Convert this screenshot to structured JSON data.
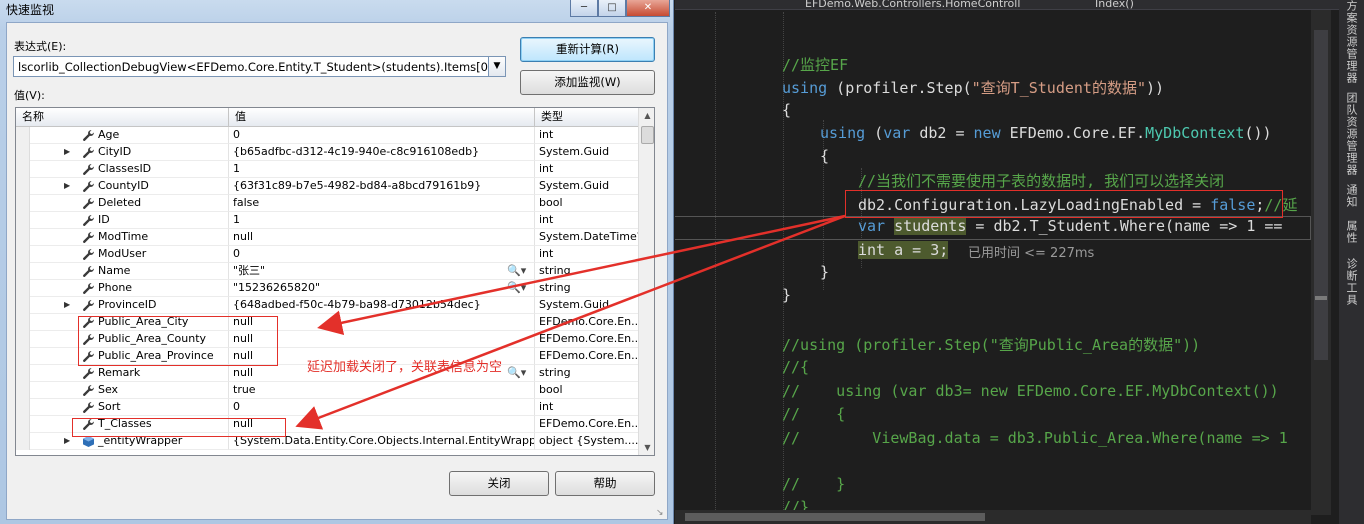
{
  "dialog": {
    "title": "快速监视",
    "expression_label": "表达式(E):",
    "expression_value": "lscorlib_CollectionDebugView<EFDemo.Core.Entity.T_Student>(students).Items[0]",
    "value_label": "值(V):",
    "recalc_button": "重新计算(R)",
    "add_watch_button": "添加监视(W)",
    "close_button": "关闭",
    "help_button": "帮助",
    "columns": [
      "名称",
      "值",
      "类型"
    ],
    "rows": [
      {
        "name": "Age",
        "value": "0",
        "type": "int",
        "expand": false
      },
      {
        "name": "CityID",
        "value": "{b65adfbc-d312-4c19-940e-c8c916108edb}",
        "type": "System.Guid",
        "expand": true
      },
      {
        "name": "ClassesID",
        "value": "1",
        "type": "int",
        "expand": false
      },
      {
        "name": "CountyID",
        "value": "{63f31c89-b7e5-4982-bd84-a8bcd79161b9}",
        "type": "System.Guid",
        "expand": true
      },
      {
        "name": "Deleted",
        "value": "false",
        "type": "bool",
        "expand": false
      },
      {
        "name": "ID",
        "value": "1",
        "type": "int",
        "expand": false
      },
      {
        "name": "ModTime",
        "value": "null",
        "type": "System.DateTime?",
        "expand": false
      },
      {
        "name": "ModUser",
        "value": "0",
        "type": "int",
        "expand": false
      },
      {
        "name": "Name",
        "value": "\"张三\"",
        "type": "string",
        "expand": false
      },
      {
        "name": "Phone",
        "value": "\"15236265820\"",
        "type": "string",
        "expand": false
      },
      {
        "name": "ProvinceID",
        "value": "{648adbed-f50c-4b79-ba98-d73012b54dec}",
        "type": "System.Guid",
        "expand": true
      },
      {
        "name": "Public_Area_City",
        "value": "null",
        "type": "EFDemo.Core.En...",
        "expand": false
      },
      {
        "name": "Public_Area_County",
        "value": "null",
        "type": "EFDemo.Core.En...",
        "expand": false
      },
      {
        "name": "Public_Area_Province",
        "value": "null",
        "type": "EFDemo.Core.En...",
        "expand": false
      },
      {
        "name": "Remark",
        "value": "null",
        "type": "string",
        "expand": false
      },
      {
        "name": "Sex",
        "value": "true",
        "type": "bool",
        "expand": false
      },
      {
        "name": "Sort",
        "value": "0",
        "type": "int",
        "expand": false
      },
      {
        "name": "T_Classes",
        "value": "null",
        "type": "EFDemo.Core.En...",
        "expand": false
      },
      {
        "name": "_entityWrapper",
        "value": "{System.Data.Entity.Core.Objects.Internal.EntityWrappe...",
        "type": "object {System....",
        "expand": true
      }
    ]
  },
  "annotation": "延迟加载关闭了，关联表信息为空",
  "editor": {
    "nav_left": "EFDemo.Web.Controllers.HomeControll",
    "nav_right": "Index()",
    "elapsed": "已用时间 <= 227ms",
    "side_tabs": [
      "方案资源管理器",
      "团队资源管理器",
      "通知",
      "属性",
      "诊断工具"
    ]
  },
  "colors": {
    "annotation": "#e3302a",
    "keyword": "#569cd6",
    "comment": "#57a64a",
    "type": "#4ec9b0"
  }
}
